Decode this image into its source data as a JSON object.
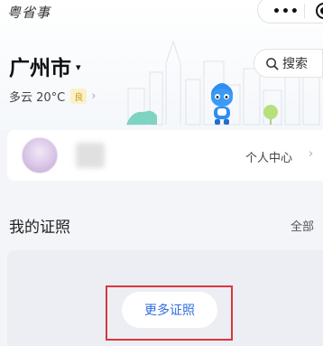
{
  "app": {
    "name": "粤省事"
  },
  "location": {
    "city": "广州市",
    "caret": "▾"
  },
  "search": {
    "label": "搜索"
  },
  "weather": {
    "text": "多云 20°C",
    "aqi": "良",
    "chevron": "›"
  },
  "user_card": {
    "center_label": "个人中心",
    "chevron": "›"
  },
  "certificates": {
    "title": "我的证照",
    "all_label": "全部",
    "more_button": "更多证照"
  },
  "colors": {
    "highlight": "#d9363e",
    "link_blue": "#2f6fe0",
    "aqi_bg": "#fbf1c9"
  },
  "icons": [
    "more-dots-icon",
    "target-icon",
    "search-icon",
    "dropdown-caret-icon",
    "chevron-right-icon",
    "mascot-illustration",
    "skyline-illustration"
  ]
}
